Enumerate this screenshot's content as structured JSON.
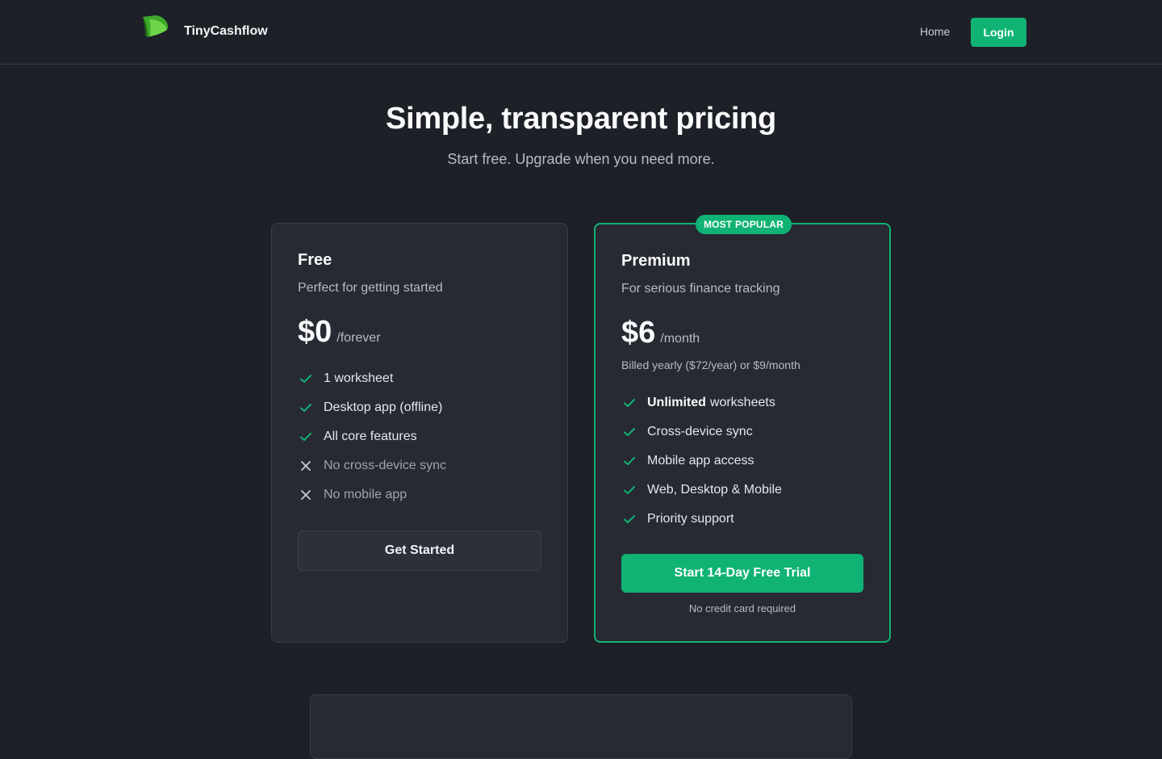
{
  "header": {
    "brand": "TinyCashflow",
    "nav_home": "Home",
    "login_label": "Login"
  },
  "hero": {
    "title": "Simple, transparent pricing",
    "subtitle": "Start free. Upgrade when you need more."
  },
  "plans": [
    {
      "name": "Free",
      "description": "Perfect for getting started",
      "price": "$0",
      "period": "/forever",
      "features": [
        {
          "text": "1 worksheet",
          "included": true
        },
        {
          "text": "Desktop app (offline)",
          "included": true
        },
        {
          "text": "All core features",
          "included": true
        },
        {
          "text": "No cross-device sync",
          "included": false
        },
        {
          "text": "No mobile app",
          "included": false
        }
      ],
      "cta": "Get Started"
    },
    {
      "badge": "MOST POPULAR",
      "name": "Premium",
      "description": "For serious finance tracking",
      "price": "$6",
      "period": "/month",
      "billing": "Billed yearly ($72/year) or $9/month",
      "features": [
        {
          "strong": "Unlimited",
          "text": "worksheets",
          "included": true
        },
        {
          "text": "Cross-device sync",
          "included": true
        },
        {
          "text": "Mobile app access",
          "included": true
        },
        {
          "text": "Web, Desktop & Mobile",
          "included": true
        },
        {
          "text": "Priority support",
          "included": true
        }
      ],
      "cta": "Start 14-Day Free Trial",
      "fine_print": "No credit card required"
    }
  ],
  "colors": {
    "accent": "#10b373",
    "background": "#1e2028",
    "card": "#272a33"
  },
  "icons": {
    "logo": "leaf-logo-icon",
    "included": "check-icon",
    "excluded": "x-icon"
  }
}
